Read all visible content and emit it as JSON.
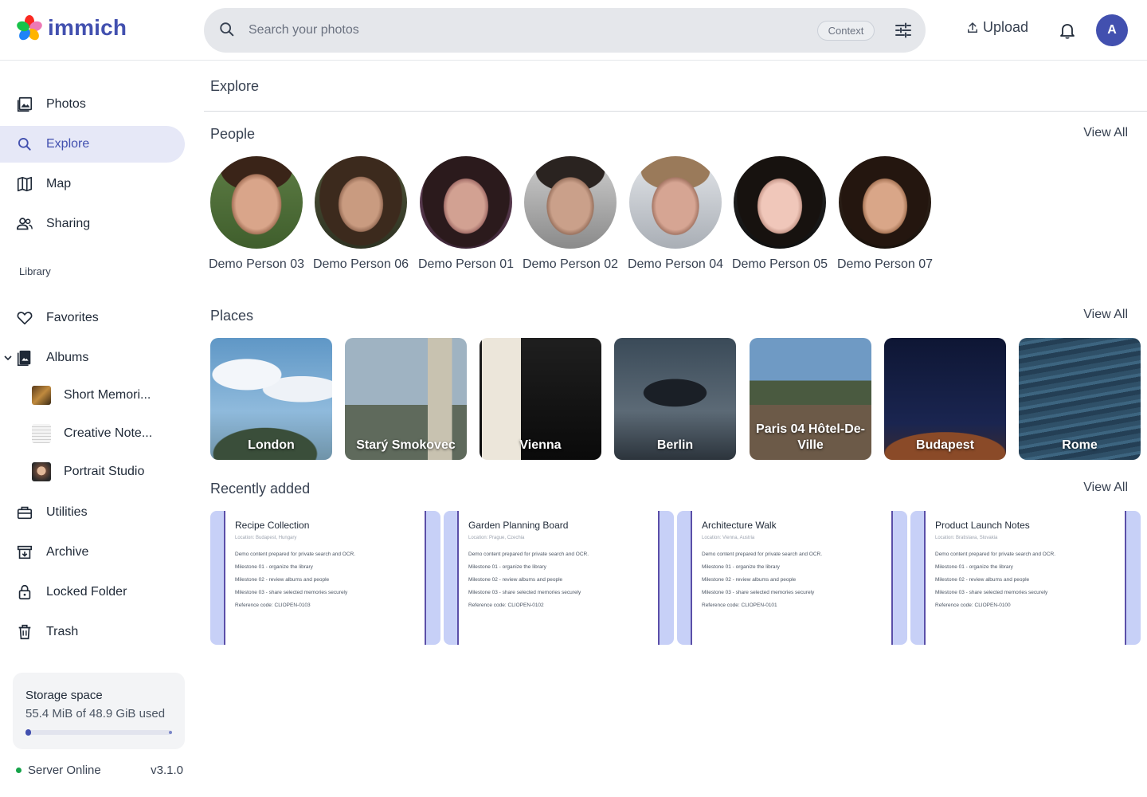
{
  "header": {
    "app_name": "immich",
    "search_placeholder": "Search your photos",
    "context_chip": "Context",
    "upload_label": "Upload",
    "avatar_initial": "A"
  },
  "sidebar": {
    "nav": [
      {
        "label": "Photos",
        "icon": "photos-icon"
      },
      {
        "label": "Explore",
        "icon": "search-icon",
        "active": true
      },
      {
        "label": "Map",
        "icon": "map-icon"
      },
      {
        "label": "Sharing",
        "icon": "sharing-icon"
      }
    ],
    "library_label": "Library",
    "library": [
      {
        "label": "Favorites",
        "icon": "heart-icon"
      },
      {
        "label": "Albums",
        "icon": "album-icon"
      }
    ],
    "albums": [
      {
        "label": "Short Memori..."
      },
      {
        "label": "Creative Note..."
      },
      {
        "label": "Portrait Studio"
      }
    ],
    "more": [
      {
        "label": "Utilities",
        "icon": "toolbox-icon"
      },
      {
        "label": "Archive",
        "icon": "archive-icon"
      },
      {
        "label": "Locked Folder",
        "icon": "lock-icon"
      },
      {
        "label": "Trash",
        "icon": "trash-icon"
      }
    ],
    "storage": {
      "title": "Storage space",
      "used_text": "55.4 MiB of 48.9 GiB used",
      "used_fraction": 0.0011
    },
    "server": {
      "status": "Server Online",
      "version": "v3.1.0"
    }
  },
  "main": {
    "page_title": "Explore",
    "people": {
      "title": "People",
      "view_all": "View All",
      "items": [
        {
          "name": "Demo Person 03"
        },
        {
          "name": "Demo Person 06"
        },
        {
          "name": "Demo Person 01"
        },
        {
          "name": "Demo Person 02"
        },
        {
          "name": "Demo Person 04"
        },
        {
          "name": "Demo Person 05"
        },
        {
          "name": "Demo Person 07"
        }
      ]
    },
    "places": {
      "title": "Places",
      "view_all": "View All",
      "items": [
        {
          "name": "London"
        },
        {
          "name": "Starý Smokovec"
        },
        {
          "name": "Vienna"
        },
        {
          "name": "Berlin"
        },
        {
          "name": "Paris 04 Hôtel-De-Ville"
        },
        {
          "name": "Budapest"
        },
        {
          "name": "Rome"
        }
      ]
    },
    "recent": {
      "title": "Recently added",
      "view_all": "View All",
      "items": [
        {
          "title": "Recipe Collection",
          "location": "Location: Budapest, Hungary",
          "lines": [
            "Demo content prepared for private search and OCR.",
            "Milestone 01 - organize the library",
            "Milestone 02 - review albums and people",
            "Milestone 03 - share selected memories securely",
            "Reference code: CLIOPEN-0103"
          ]
        },
        {
          "title": "Garden Planning Board",
          "location": "Location: Prague, Czechia",
          "lines": [
            "Demo content prepared for private search and OCR.",
            "Milestone 01 - organize the library",
            "Milestone 02 - review albums and people",
            "Milestone 03 - share selected memories securely",
            "Reference code: CLIOPEN-0102"
          ]
        },
        {
          "title": "Architecture Walk",
          "location": "Location: Vienna, Austria",
          "lines": [
            "Demo content prepared for private search and OCR.",
            "Milestone 01 - organize the library",
            "Milestone 02 - review albums and people",
            "Milestone 03 - share selected memories securely",
            "Reference code: CLIOPEN-0101"
          ]
        },
        {
          "title": "Product Launch Notes",
          "location": "Location: Bratislava, Slovakia",
          "lines": [
            "Demo content prepared for private search and OCR.",
            "Milestone 01 - organize the library",
            "Milestone 02 - review albums and people",
            "Milestone 03 - share selected memories securely",
            "Reference code: CLIOPEN-0100"
          ]
        }
      ]
    }
  },
  "colors": {
    "brand": "#4250af",
    "active_nav_bg": "#e6e8f7",
    "server_online": "#16a34a"
  }
}
